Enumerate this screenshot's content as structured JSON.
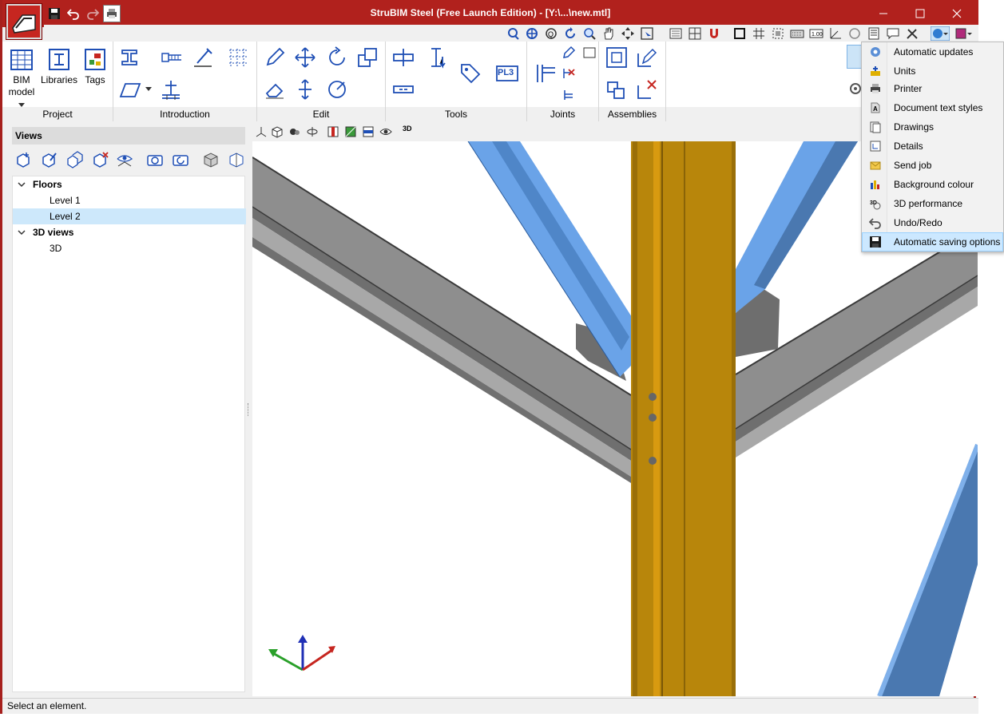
{
  "window": {
    "title": "StruBIM Steel (Free Launch Edition) - [Y:\\...\\new.mtl]",
    "accent": "#b1211d"
  },
  "quick_access": [
    "save-icon",
    "undo-icon",
    "redo-icon",
    "print-icon"
  ],
  "ribbon": {
    "groups": {
      "project": "Project",
      "introduction": "Introduction",
      "edit": "Edit",
      "tools": "Tools",
      "joints": "Joints",
      "assemblies": "Assemblies"
    },
    "buttons": {
      "bim_model_line1": "BIM",
      "bim_model_line2": "model",
      "libraries": "Libraries",
      "tags": "Tags",
      "pl3": "PL3"
    }
  },
  "views": {
    "title": "Views",
    "tree": {
      "floors": "Floors",
      "level1": "Level 1",
      "level2": "Level 2",
      "views3d": "3D views",
      "view3d": "3D"
    },
    "selected": "Level 2"
  },
  "canvas_toolbar": {
    "label_3d": "3D"
  },
  "menu": {
    "items": [
      {
        "label": "Automatic updates",
        "icon": "gear-update-icon"
      },
      {
        "label": "Units",
        "icon": "units-icon"
      },
      {
        "label": "Printer",
        "icon": "printer-icon"
      },
      {
        "label": "Document text styles",
        "icon": "text-styles-icon"
      },
      {
        "label": "Drawings",
        "icon": "drawings-icon"
      },
      {
        "label": "Details",
        "icon": "details-icon"
      },
      {
        "label": "Send job",
        "icon": "send-job-icon"
      },
      {
        "label": "Background colour",
        "icon": "background-colour-icon"
      },
      {
        "label": "3D performance",
        "icon": "3d-performance-icon"
      },
      {
        "label": "Undo/Redo",
        "icon": "undo-redo-icon"
      },
      {
        "label": "Automatic saving options",
        "icon": "automatic-saving-icon"
      }
    ],
    "highlighted": "Automatic saving options"
  },
  "status": {
    "text": "Select an element."
  },
  "colors": {
    "column": "#b8860b",
    "brace": "#6a9fd9",
    "beam": "#8a8a8a",
    "selection": "#cde8fb"
  }
}
